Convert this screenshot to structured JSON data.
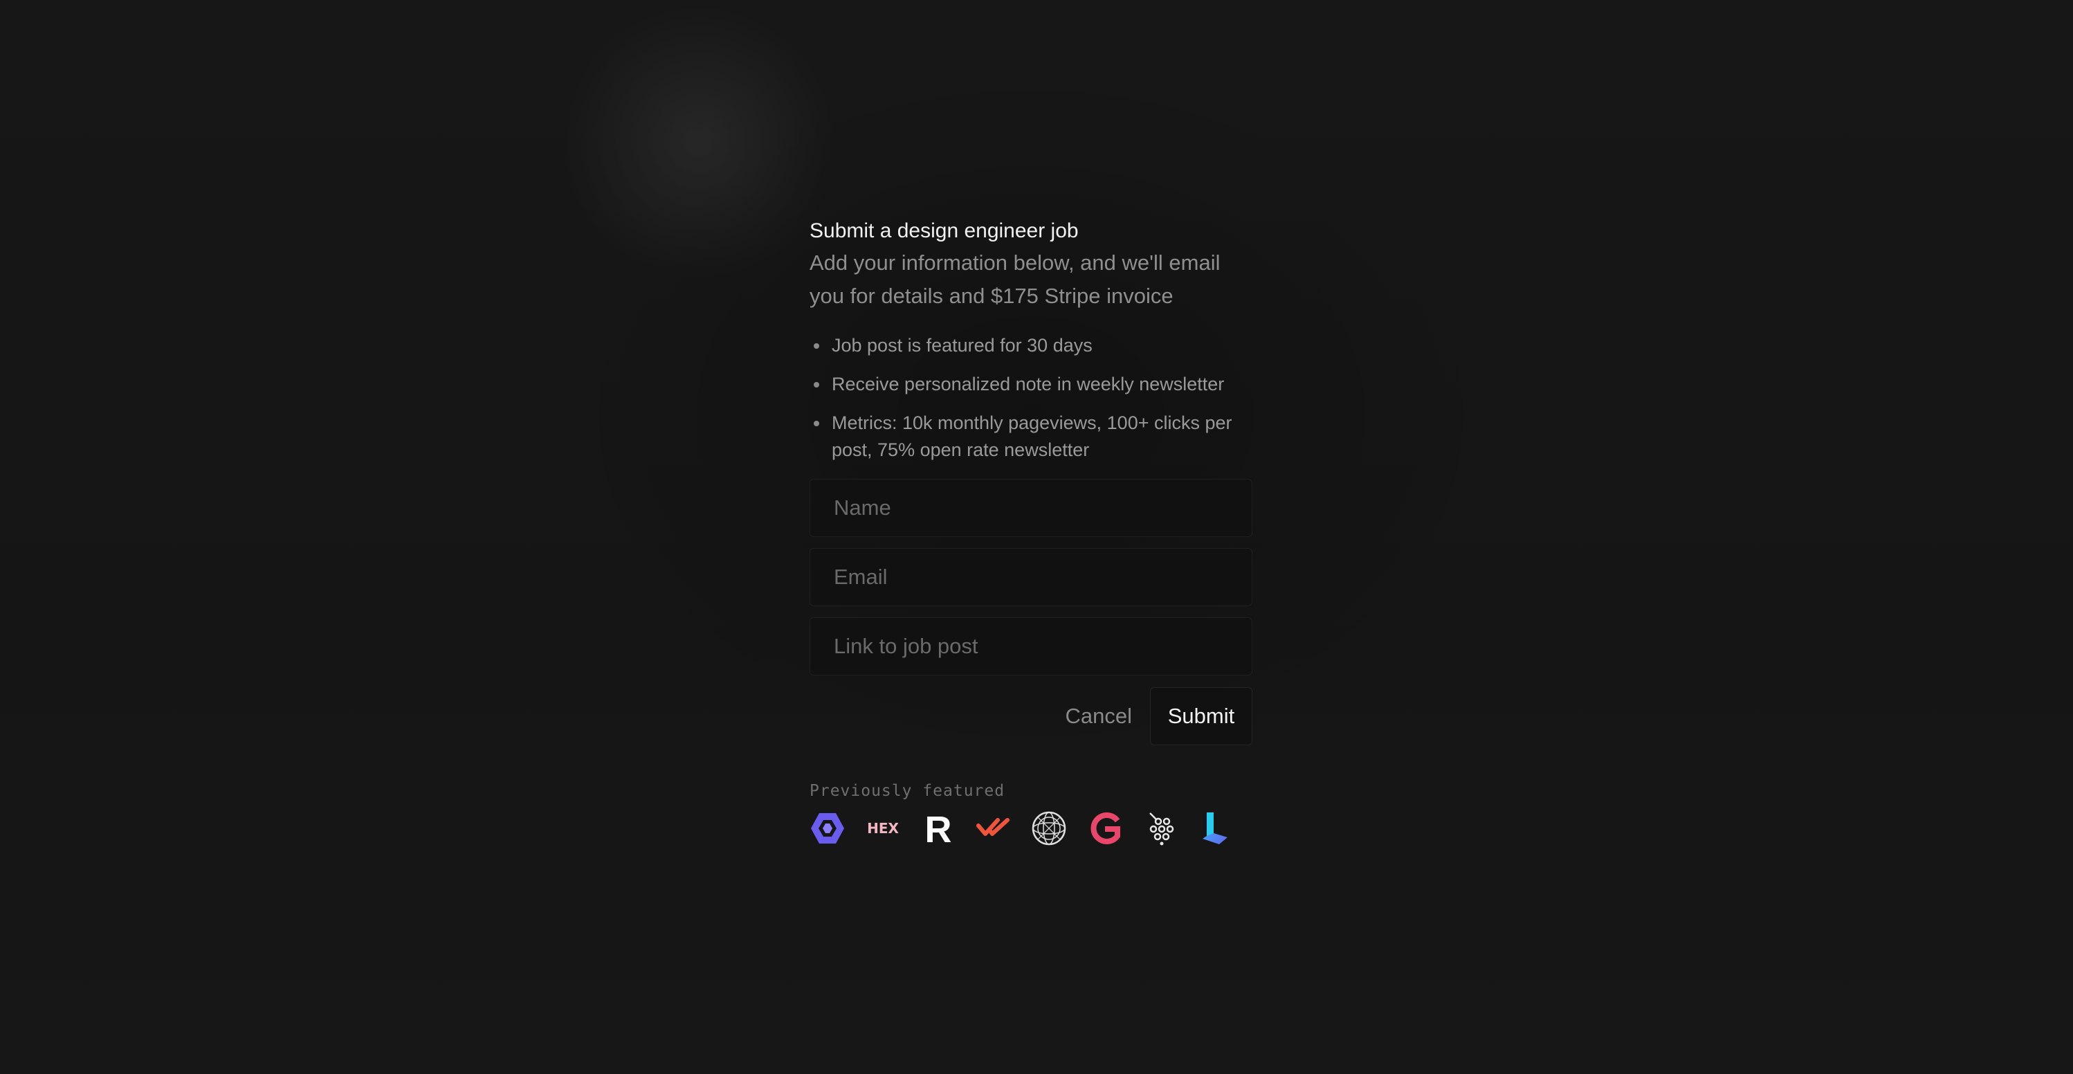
{
  "form": {
    "title": "Submit a design engineer job",
    "subtitle": "Add your information below, and we'll email you for details and $175 Stripe invoice",
    "benefits": [
      "Job post is featured for 30 days",
      "Receive personalized note in weekly newsletter",
      "Metrics: 10k monthly pageviews, 100+ clicks per post, 75% open rate newsletter"
    ],
    "fields": {
      "name_placeholder": "Name",
      "email_placeholder": "Email",
      "link_placeholder": "Link to job post"
    },
    "cancel_label": "Cancel",
    "submit_label": "Submit"
  },
  "featured": {
    "label": "Previously featured",
    "logos": [
      {
        "icon": "hexagon-chevron-logo-icon",
        "color": "#6b5cf0"
      },
      {
        "icon": "hex-wordmark-logo-icon",
        "text": "HEX",
        "color": "#f3b7c4"
      },
      {
        "icon": "r-letter-logo-icon",
        "text": "R",
        "color": "#ffffff"
      },
      {
        "icon": "double-check-logo-icon",
        "color": "#f0553c"
      },
      {
        "icon": "globe-wireframe-logo-icon",
        "color": "#e0e0e0"
      },
      {
        "icon": "g-arc-logo-icon",
        "color": "#e8466a"
      },
      {
        "icon": "dot-cluster-logo-icon",
        "color": "#e8e8e8"
      },
      {
        "icon": "gradient-l-logo-icon",
        "color": "#3b82f6"
      }
    ]
  }
}
